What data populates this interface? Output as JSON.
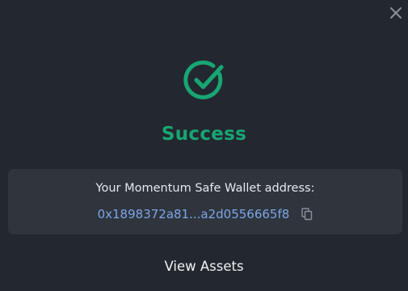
{
  "modal": {
    "title": "Success",
    "wallet_label": "Your Momentum Safe Wallet address:",
    "wallet_address": "0x1898372a81...a2d0556665f8",
    "view_assets_label": "View Assets"
  },
  "icons": {
    "close": "close-icon",
    "success": "check-circle-icon",
    "copy": "copy-icon"
  },
  "colors": {
    "background": "#23272f",
    "panel": "#2f343d",
    "success_green": "#17a673",
    "address_blue": "#7da6e8",
    "text_light": "#e7e9ec",
    "icon_gray": "#8a9099"
  }
}
